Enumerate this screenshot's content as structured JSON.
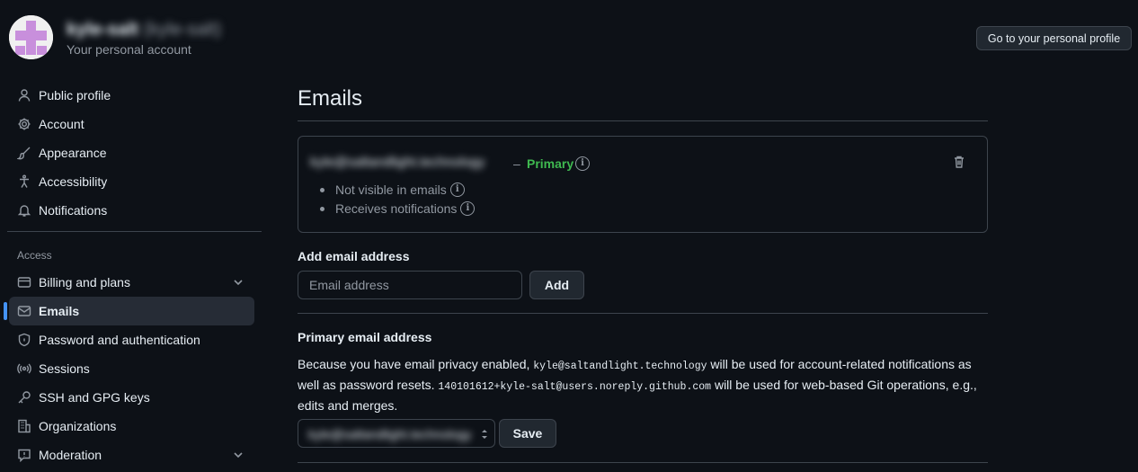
{
  "header": {
    "user_name": "kyle-salt",
    "user_handle": "(kyle-salt)",
    "subtitle": "Your personal account",
    "profile_button": "Go to your personal profile"
  },
  "sidebar": {
    "items": [
      {
        "label": "Public profile",
        "icon": "person-icon"
      },
      {
        "label": "Account",
        "icon": "gear-icon"
      },
      {
        "label": "Appearance",
        "icon": "paintbrush-icon"
      },
      {
        "label": "Accessibility",
        "icon": "accessibility-icon"
      },
      {
        "label": "Notifications",
        "icon": "bell-icon"
      }
    ],
    "access_heading": "Access",
    "access_items": [
      {
        "label": "Billing and plans",
        "icon": "credit-card-icon",
        "expandable": true
      },
      {
        "label": "Emails",
        "icon": "mail-icon",
        "active": true
      },
      {
        "label": "Password and authentication",
        "icon": "shield-lock-icon"
      },
      {
        "label": "Sessions",
        "icon": "broadcast-icon"
      },
      {
        "label": "SSH and GPG keys",
        "icon": "key-icon"
      },
      {
        "label": "Organizations",
        "icon": "organization-icon"
      },
      {
        "label": "Moderation",
        "icon": "report-icon",
        "expandable": true
      }
    ]
  },
  "main": {
    "title": "Emails",
    "email_entry": {
      "address": "kyle@saltandlight.technology",
      "separator": "–",
      "badge": "Primary",
      "bullets": [
        "Not visible in emails",
        "Receives notifications"
      ]
    },
    "add_email": {
      "label": "Add email address",
      "placeholder": "Email address",
      "button": "Add"
    },
    "primary_email": {
      "label": "Primary email address",
      "desc_1": "Because you have email privacy enabled, ",
      "code_1": "kyle@saltandlight.technology",
      "desc_2": " will be used for account-related notifications as well as password resets. ",
      "code_2": "140101612+kyle-salt@users.noreply.github.com",
      "desc_3": " will be used for web-based Git operations, e.g., edits and merges.",
      "selected": "kyle@saltandlight.technology",
      "save_button": "Save"
    }
  },
  "colors": {
    "background": "#0d1117",
    "primary_green": "#3fb950",
    "active_accent": "#4493f8",
    "border": "#3d444d"
  }
}
